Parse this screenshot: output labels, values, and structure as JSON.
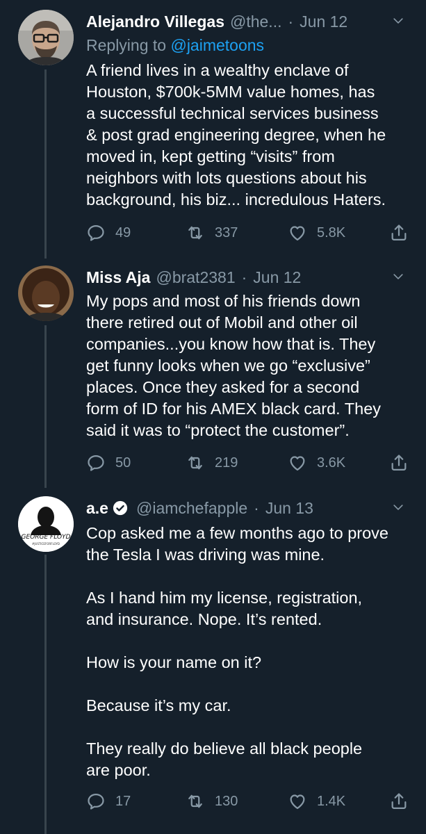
{
  "tweets": [
    {
      "name": "Alejandro Villegas",
      "handle": "@the...",
      "date": "Jun 12",
      "replying_label": "Replying to",
      "replying_handle": "@jaimetoons",
      "text": "A friend lives in a wealthy enclave of\nHouston, $700k-5MM value homes, has\na successful technical services business\n& post grad engineering degree, when he\nmoved in, kept getting “visits” from\nneighbors with lots questions about his\nbackground, his biz... incredulous Haters.",
      "replies": "49",
      "retweets": "337",
      "likes": "5.8K"
    },
    {
      "name": "Miss Aja",
      "handle": "@brat2381",
      "date": "Jun 12",
      "text": "My pops and most of his friends  down\nthere retired out of Mobil and other oil\ncompanies...you know how that is. They\nget funny looks when we go “exclusive”\nplaces. Once they asked for a second\nform of ID for his AMEX black card. They\nsaid it was to “protect the customer”.",
      "replies": "50",
      "retweets": "219",
      "likes": "3.6K"
    },
    {
      "name": "a.e",
      "handle": "@iamchefapple",
      "date": "Jun 13",
      "avatar_text": "GEORGE FLOYD",
      "avatar_subtext": "#JUSTICEFORFLOYD",
      "text": "Cop asked me a few months ago to prove\nthe Tesla I was driving was mine.\n\nAs I hand him my license, registration,\nand insurance. Nope. It’s rented.\n\nHow is your name on it?\n\nBecause it’s my car.\n\nThey really do believe all black people\nare poor.",
      "replies": "17",
      "retweets": "130",
      "likes": "1.4K"
    }
  ],
  "colors": {
    "background": "#15202b",
    "secondary_text": "#8899a6",
    "link": "#1da1f2",
    "thread_line": "#38444d"
  },
  "icons": [
    "chevron-down-icon",
    "reply-icon",
    "retweet-icon",
    "like-icon",
    "share-icon",
    "verified-badge-icon"
  ]
}
